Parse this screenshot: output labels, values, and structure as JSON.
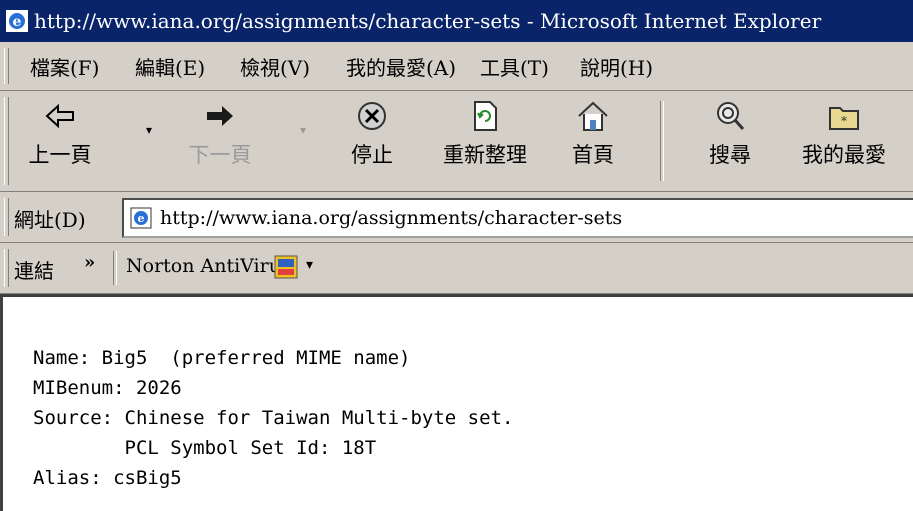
{
  "window": {
    "title": "http://www.iana.org/assignments/character-sets - Microsoft Internet Explorer"
  },
  "menu": [
    {
      "label": "檔案(F)"
    },
    {
      "label": "編輯(E)"
    },
    {
      "label": "檢視(V)"
    },
    {
      "label": "我的最愛(A)"
    },
    {
      "label": "工具(T)"
    },
    {
      "label": "說明(H)"
    }
  ],
  "toolbar": {
    "back": "上一頁",
    "forward": "下一頁",
    "stop": "停止",
    "refresh": "重新整理",
    "home": "首頁",
    "search": "搜尋",
    "favorites": "我的最愛"
  },
  "address": {
    "label": "網址(D)",
    "url": "http://www.iana.org/assignments/character-sets"
  },
  "links": {
    "label": "連結",
    "chevron": "»",
    "item": "Norton AntiVirus",
    "dropdown": "▾"
  },
  "content": {
    "lines": [
      "Name: Big5  (preferred MIME name)",
      "MIBenum: 2026",
      "Source: Chinese for Taiwan Multi-byte set.",
      "        PCL Symbol Set Id: 18T",
      "Alias: csBig5"
    ]
  },
  "icons": {
    "ie": "ie-logo-icon",
    "back": "back-arrow-icon",
    "forward": "forward-arrow-icon",
    "stop": "stop-icon",
    "refresh": "refresh-icon",
    "home": "home-icon",
    "search": "search-icon",
    "favorites": "favorites-icon",
    "norton": "norton-icon"
  }
}
